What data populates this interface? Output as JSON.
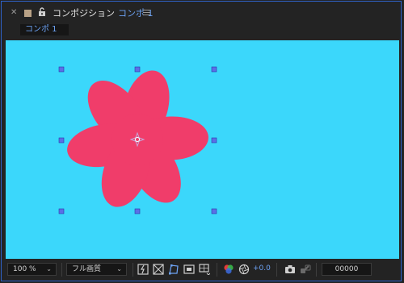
{
  "panel": {
    "title": "コンポジション",
    "comp_name": "コンポ 1",
    "tab_label": "コンポ 1"
  },
  "toolbar": {
    "zoom": "100 %",
    "resolution": "フル画質",
    "exposure": "+0.0",
    "timecode": "00000"
  },
  "icons": [
    "close-icon",
    "label-color-swatch",
    "lock-icon",
    "panel-menu-icon",
    "fast-previews-icon",
    "transparency-grid-icon",
    "mask-path-visibility-icon",
    "region-of-interest-icon",
    "grid-guides-icon",
    "color-channels-icon",
    "reset-exposure-icon",
    "snapshot-icon",
    "show-snapshot-icon"
  ],
  "colors": {
    "viewer_bg": "#3bd7fb",
    "flower": "#f03d6a",
    "accent_blue": "#6da3f5",
    "handle": "#5b6fe6"
  }
}
